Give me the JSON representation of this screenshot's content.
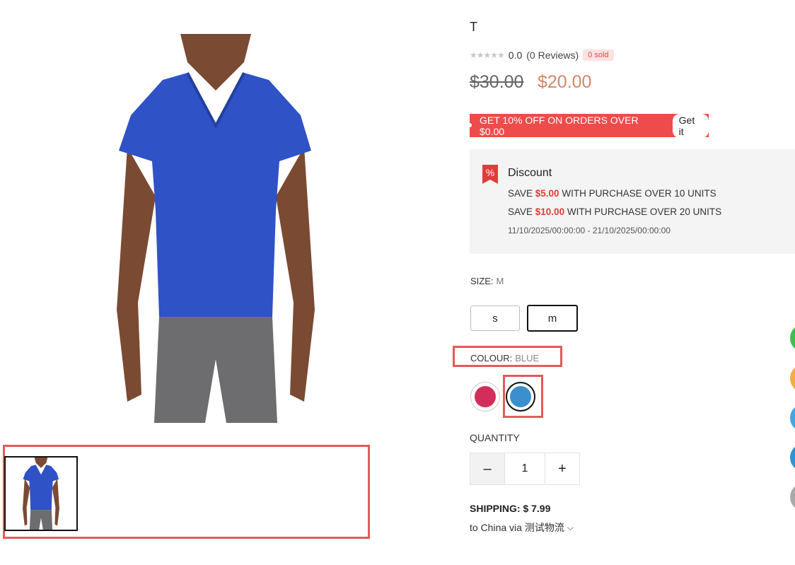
{
  "product": {
    "title": "T",
    "rating_value": "0.0",
    "reviews_text": "(0 Reviews)",
    "sold_badge": "0 sold",
    "price_original": "$30.00",
    "price_sale": "$20.00"
  },
  "coupon": {
    "text": "GET 10% OFF ON ORDERS OVER $0.00",
    "button_label": "Get it"
  },
  "discount": {
    "icon": "percent-tag-icon",
    "title": "Discount",
    "lines": [
      {
        "prefix": "SAVE ",
        "amount": "$5.00",
        "suffix": " WITH PURCHASE OVER 10 UNITS"
      },
      {
        "prefix": "SAVE ",
        "amount": "$10.00",
        "suffix": " WITH PURCHASE OVER 20 UNITS"
      }
    ],
    "date_range": "11/10/2025/00:00:00 - 21/10/2025/00:00:00"
  },
  "size": {
    "label": "SIZE:",
    "selected": "M",
    "options": [
      "s",
      "m"
    ]
  },
  "colour": {
    "label": "COLOUR:",
    "selected": "BLUE",
    "swatches": [
      {
        "color": "#d22e5c"
      },
      {
        "color": "#3b8fcc"
      }
    ]
  },
  "quantity": {
    "label": "QUANTITY",
    "value": "1",
    "minus": "–",
    "plus": "+"
  },
  "shipping": {
    "label": "SHIPPING: $ 7.99",
    "to_text": "to China via 测试物流",
    "chevron": "⌵"
  },
  "colors": {
    "accent_red": "#ee4b4b",
    "sale_price": "#d3866b",
    "shirt_blue": "#2f52c6"
  }
}
